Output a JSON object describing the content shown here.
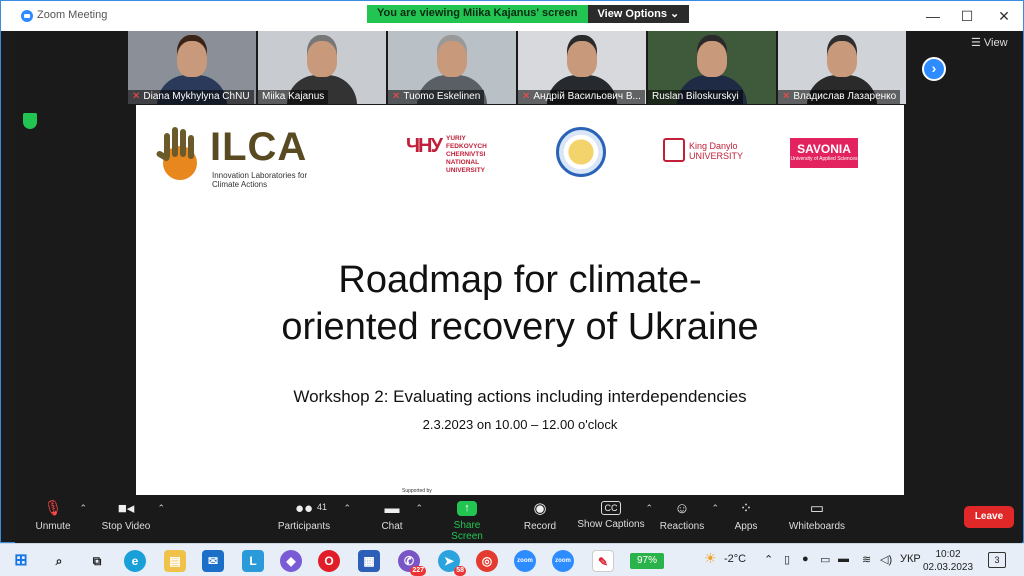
{
  "window": {
    "title": "Zoom Meeting",
    "minimize": "—",
    "maximize": "☐",
    "close": "✕"
  },
  "banner": {
    "viewing": "You are viewing Miika Kajanus' screen",
    "view_options": "View Options ⌄"
  },
  "participants_strip": [
    {
      "name": "Diana Mykhylyna ChNU",
      "muted": true,
      "bg": "#8a8f98",
      "hair": "#3a2418",
      "shirt": "#2b3a5a"
    },
    {
      "name": "Miika Kajanus",
      "muted": false,
      "bg": "#c8ccd0",
      "hair": "#777",
      "shirt": "#333"
    },
    {
      "name": "Tuomo Eskelinen",
      "muted": true,
      "bg": "#b9c0c6",
      "hair": "#999",
      "shirt": "#5a5f66"
    },
    {
      "name": "Андрій Васильович В...",
      "muted": true,
      "bg": "#d7d9dc",
      "hair": "#2a2a2a",
      "shirt": "#26292e"
    },
    {
      "name": "Ruslan Biloskurskyi",
      "muted": false,
      "bg": "#3f5a3a",
      "hair": "#2a2a2a",
      "shirt": "#1f2a44"
    },
    {
      "name": "Владислав Лазаренко",
      "muted": true,
      "bg": "#d0d4d8",
      "hair": "#2e2e2e",
      "shirt": "#2a2a2a"
    }
  ],
  "view_button": "☰ View",
  "slide": {
    "ilca_title": "ILCA",
    "ilca_subtitle": "Innovation Laboratories for Climate Actions",
    "cnu_text": "YURIY FEDKOVYCH CHERNIVTSI NATIONAL UNIVERSITY",
    "cnu_mark": "ЧНУ",
    "king_danylo": "King Danylo UNIVERSITY",
    "savonia": "SAVONIA",
    "savonia_sub": "University of Applied Sciences",
    "headline_line1": "Roadmap for climate-",
    "headline_line2": "oriented recovery of Ukraine",
    "workshop": "Workshop 2: Evaluating actions including interdependencies",
    "date": "2.3.2023 on 10.00 – 12.00 o'clock",
    "supported": "Supported by"
  },
  "toolbar": {
    "unmute": "Unmute",
    "stop_video": "Stop Video",
    "participants": "Participants",
    "participants_count": "41",
    "chat": "Chat",
    "share_screen": "Share Screen",
    "record": "Record",
    "show_captions": "Show Captions",
    "reactions": "Reactions",
    "apps": "Apps",
    "whiteboards": "Whiteboards",
    "leave": "Leave"
  },
  "taskbar": {
    "battery": "97%",
    "temperature": "-2°C",
    "language": "УКР",
    "time": "10:02",
    "date": "02.03.2023",
    "notifications": "3",
    "viber_badge": "227",
    "telegram_badge": "58"
  },
  "colors": {
    "zoom_blue": "#2d8cff",
    "share_green": "#23c552",
    "leave_red": "#e02828"
  }
}
